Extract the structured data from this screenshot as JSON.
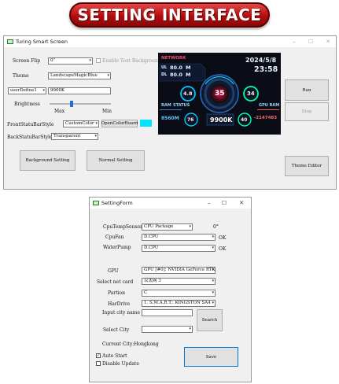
{
  "banner": {
    "title": "SETTING INTERFACE"
  },
  "main_window": {
    "title": "Turing Smart Screen",
    "screen_flip": {
      "label": "Screen Flip",
      "value": "0°"
    },
    "enable_text_bg": {
      "label": "Enable Text Background",
      "checked": false
    },
    "theme": {
      "label": "Theme",
      "value": "LandscapeMagicBlue"
    },
    "user_define": {
      "value": "userDefine1",
      "text": "9900K"
    },
    "brightness": {
      "label": "Brightness",
      "max_label": "Max",
      "min_label": "Min",
      "level_fraction": 0.35
    },
    "front_bar": {
      "label": "FrontStatuBarStyle",
      "value": "CustomColor",
      "button": "OpenColorBoard",
      "swatch": "#00e5ff"
    },
    "back_bar": {
      "label": "BackStatuBarStyle",
      "value": "Transparent"
    },
    "buttons": {
      "background_setting": "Background Setting",
      "normal_setting": "Normal Setting",
      "run": "Run",
      "stop": "Stop",
      "theme_editor": "Theme Editor"
    }
  },
  "preview": {
    "network": "NETWORK",
    "date": "2024/5/8",
    "time": "23:58",
    "ul_label": "UL",
    "ul_value": "80.0",
    "ul_unit": "M",
    "dl_label": "DL",
    "dl_value": "80.0",
    "dl_unit": "M",
    "center_value": "35",
    "right_gauge": "34",
    "left_gauge": "4.8",
    "ram_label": "RAM",
    "status_label": "STATUS",
    "gpu_ram_label": "GPU RAM",
    "ram_value": "8560M",
    "small_gauge_left": "76",
    "cpu_model": "9900K",
    "small_gauge_right": "40",
    "gpu_ram_value": "-2147483"
  },
  "setting_form": {
    "title": "SettingForm",
    "cpu_temp": {
      "label": "CpuTempSensor",
      "value": "CPU Package",
      "reading": "0°"
    },
    "cpu_fan": {
      "label": "CpuFan",
      "value": "D.CPU",
      "ok": "OK"
    },
    "water_pump": {
      "label": "WaterPump",
      "value": "D.CPU",
      "ok": "OK"
    },
    "gpu": {
      "label": "GPU",
      "value": "GPU [#0]: NVIDIA GeForce RTX"
    },
    "net_card": {
      "label": "Select net card",
      "value": "以太网 3"
    },
    "partion": {
      "label": "Partion",
      "value": "C"
    },
    "harddrive": {
      "label": "HarDrive",
      "value": "1. S.M.A.R.T.: KINGSTON SA4"
    },
    "city_name": {
      "label": "Input city name",
      "value": ""
    },
    "select_city": {
      "label": "Select City",
      "value": ""
    },
    "search_button": "Search",
    "current_city": "Current City:Hongkong",
    "auto_start": {
      "label": "Auto Start",
      "checked": true
    },
    "disable_update": {
      "label": "Disable Update",
      "checked": false
    },
    "save_button": "Save"
  }
}
